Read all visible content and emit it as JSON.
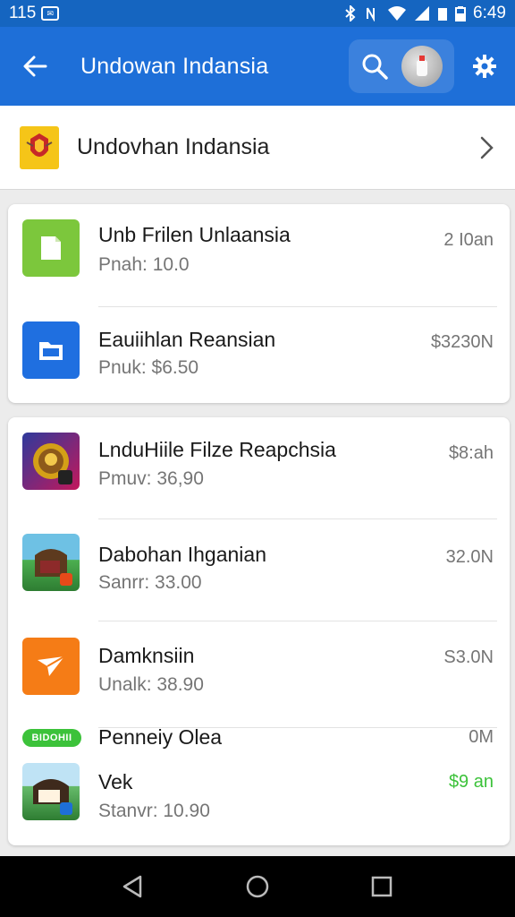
{
  "status_bar": {
    "time_left": "115",
    "time_right": "6:49"
  },
  "app_bar": {
    "title": "Undowan Indansia"
  },
  "header_row": {
    "title": "Undovhan Indansia"
  },
  "colors": {
    "primary": "#1e6fd8",
    "status_bar": "#1565c0",
    "price_green": "#3cc23a"
  },
  "list_card_1": [
    {
      "icon": "green-document-icon",
      "title": "Unb Frilen Unlaansia",
      "subtitle": "Pnah: 10.0",
      "right": "2 I0an"
    },
    {
      "icon": "blue-file-icon",
      "title": "Eauiihlan Reansian",
      "subtitle": "Pnuk: $6.50",
      "right": "$3230N"
    }
  ],
  "list_card_2": [
    {
      "icon": "emblem-app-icon",
      "title": "LnduHiile Filze Reapchsia",
      "subtitle": "Pmuv: 36,90",
      "right": "$8:ah"
    },
    {
      "icon": "landscape-app-icon",
      "title": "Dabohan Ihganian",
      "subtitle": "Sanrr: 33.00",
      "right": "32.0N"
    },
    {
      "icon": "orange-send-icon",
      "title": "Damknsiin",
      "subtitle": "Unalk: 38.90",
      "right": "S3.0N"
    },
    {
      "badge": "BIDOHII",
      "title": "Penneiy Olea",
      "right": "0M"
    },
    {
      "icon": "landscape-app-icon",
      "title": "Vek",
      "subtitle": "Stanvr: 10.90",
      "right": "$9 an"
    }
  ]
}
